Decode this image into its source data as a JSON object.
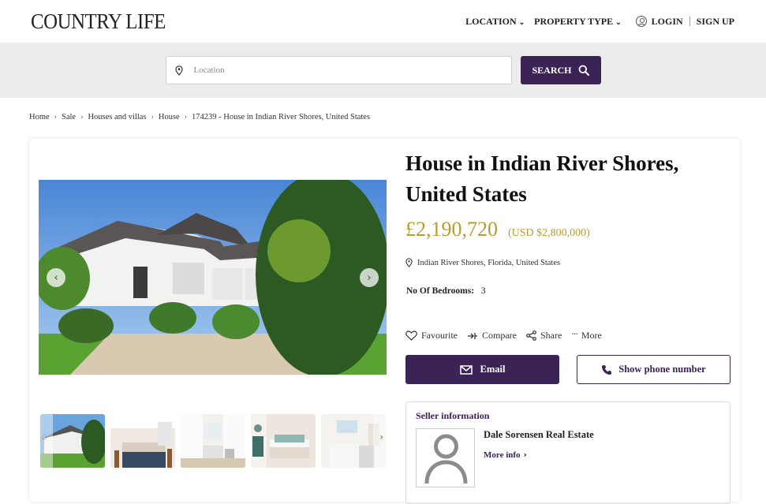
{
  "header": {
    "logo": "COUNTRY LIFE",
    "nav": {
      "location": "LOCATION",
      "property_type": "PROPERTY TYPE",
      "login": "LOGIN",
      "signup": "SIGN UP"
    }
  },
  "search": {
    "placeholder": "Location",
    "button_label": "SEARCH"
  },
  "breadcrumb": [
    "Home",
    "Sale",
    "Houses and villas",
    "House",
    "174239 - House in Indian River Shores, United States"
  ],
  "listing": {
    "title": "House in Indian River Shores, United States",
    "price": "£2,190,720",
    "price_usd": "(USD $2,800,000)",
    "location": "Indian River Shores, Florida, United States",
    "bedrooms_label": "No Of Bedrooms:",
    "bedrooms_value": "3"
  },
  "actions": {
    "favourite": "Favourite",
    "compare": "Compare",
    "share": "Share",
    "more": "More",
    "email": "Email",
    "phone": "Show phone number"
  },
  "seller": {
    "heading": "Seller information",
    "name": "Dale Sorensen Real Estate",
    "more_info": "More info"
  },
  "colors": {
    "brand": "#3b2356",
    "price": "#b99c2e"
  }
}
